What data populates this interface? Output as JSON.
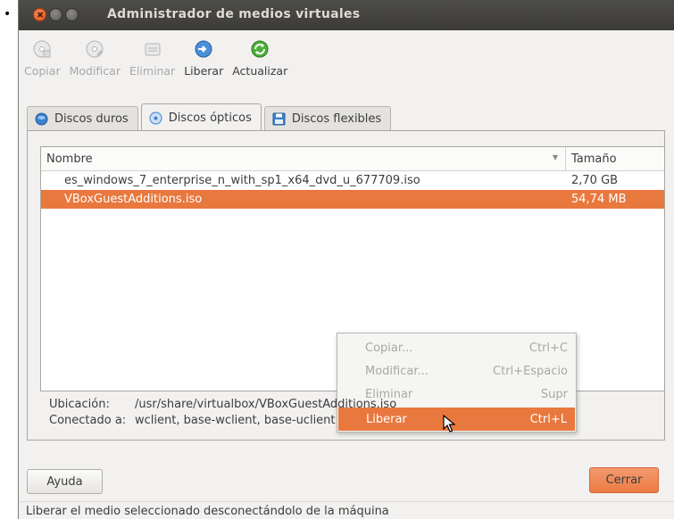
{
  "window": {
    "title": "Administrador de medios virtuales"
  },
  "toolbar": [
    {
      "label": "Copiar",
      "icon": "copy-disc-icon",
      "enabled": false
    },
    {
      "label": "Modificar",
      "icon": "modify-disc-icon",
      "enabled": false
    },
    {
      "label": "Eliminar",
      "icon": "remove-disc-icon",
      "enabled": false
    },
    {
      "label": "Liberar",
      "icon": "release-disc-icon",
      "enabled": true
    },
    {
      "label": "Actualizar",
      "icon": "refresh-icon",
      "enabled": true
    }
  ],
  "tabs": [
    {
      "label": "Discos duros",
      "icon": "hard-disk-icon",
      "active": false
    },
    {
      "label": "Discos ópticos",
      "icon": "optical-disk-icon",
      "active": true
    },
    {
      "label": "Discos flexibles",
      "icon": "floppy-disk-icon",
      "active": false
    }
  ],
  "table": {
    "columns": [
      "Nombre",
      "Tamaño"
    ],
    "rows": [
      {
        "name": "es_windows_7_enterprise_n_with_sp1_x64_dvd_u_677709.iso",
        "size": "2,70 GB",
        "selected": false
      },
      {
        "name": "VBoxGuestAdditions.iso",
        "size": "54,74 MB",
        "selected": true
      }
    ]
  },
  "context_menu": [
    {
      "label": "Copiar...",
      "shortcut": "Ctrl+C",
      "enabled": false
    },
    {
      "label": "Modificar...",
      "shortcut": "Ctrl+Espacio",
      "enabled": false
    },
    {
      "label": "Eliminar",
      "shortcut": "Supr",
      "enabled": false
    },
    {
      "label": "Liberar",
      "shortcut": "Ctrl+L",
      "enabled": true
    }
  ],
  "info": {
    "location_label": "Ubicación:",
    "location_value": "/usr/share/virtualbox/VBoxGuestAdditions.iso",
    "attached_label": "Conectado a:",
    "attached_value": "wclient, base-wclient, base-uclient"
  },
  "buttons": {
    "help": "Ayuda",
    "close": "Cerrar"
  },
  "status": "Liberar el medio seleccionado desconectándolo de la máquina",
  "colors": {
    "accent": "#e8783e",
    "titlebar": "#3c3b37",
    "window_bg": "#f2f1f0"
  }
}
